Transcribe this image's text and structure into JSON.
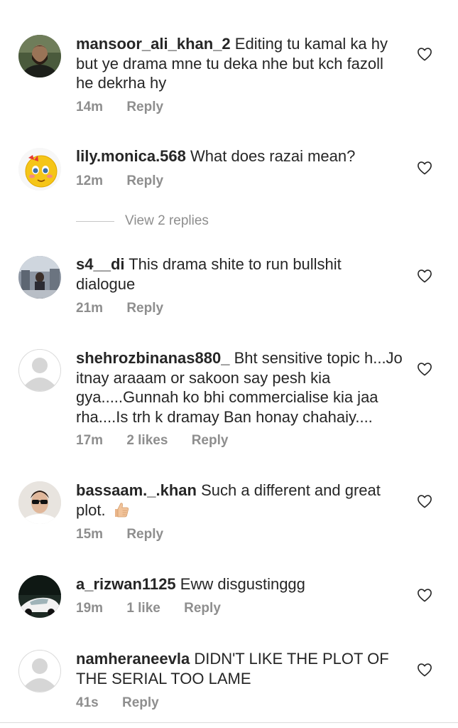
{
  "comments": [
    {
      "username": "mansoor_ali_khan_2",
      "text": "Editing tu kamal ka hy but ye drama mne tu deka nhe but kch fazoll he dekrha hy",
      "time": "14m",
      "likes": "",
      "reply": "Reply",
      "avatar": "bearded-man-photo"
    },
    {
      "username": "lily.monica.568",
      "text": "What does razai mean?",
      "time": "12m",
      "likes": "",
      "reply": "Reply",
      "avatar": "blushing-emoji"
    },
    {
      "username": "s4__di",
      "text": "This drama shite to run bullshit dialogue",
      "time": "21m",
      "likes": "",
      "reply": "Reply",
      "avatar": "street-photo"
    },
    {
      "username": "shehrozbinanas880_",
      "text": "Bht sensitive topic h...Jo itnay araaam or sakoon say pesh kia gya.....Gunnah ko bhi commercialise kia jaa rha....Is trh k dramay Ban honay chahaiy....",
      "time": "17m",
      "likes": "2 likes",
      "reply": "Reply",
      "avatar": "default-avatar"
    },
    {
      "username": "bassaam._.khan",
      "text": "Such a different and great plot.",
      "time": "15m",
      "likes": "",
      "reply": "Reply",
      "avatar": "man-sunglasses-photo"
    },
    {
      "username": "a_rizwan1125",
      "text": "Eww disgustinggg",
      "time": "19m",
      "likes": "1 like",
      "reply": "Reply",
      "avatar": "car-photo"
    },
    {
      "username": "namheraneevla",
      "text": "DIDN'T LIKE THE PLOT OF THE SERIAL TOO LAME",
      "time": "41s",
      "likes": "",
      "reply": "Reply",
      "avatar": "default-avatar"
    }
  ],
  "view_replies": "View 2 replies",
  "icons": {
    "like": "heart-outline-icon",
    "thumbs_up": "thumbs-up-emoji"
  },
  "colors": {
    "text": "#262626",
    "meta": "#8e8e8e",
    "divider": "#c7c7c7"
  }
}
